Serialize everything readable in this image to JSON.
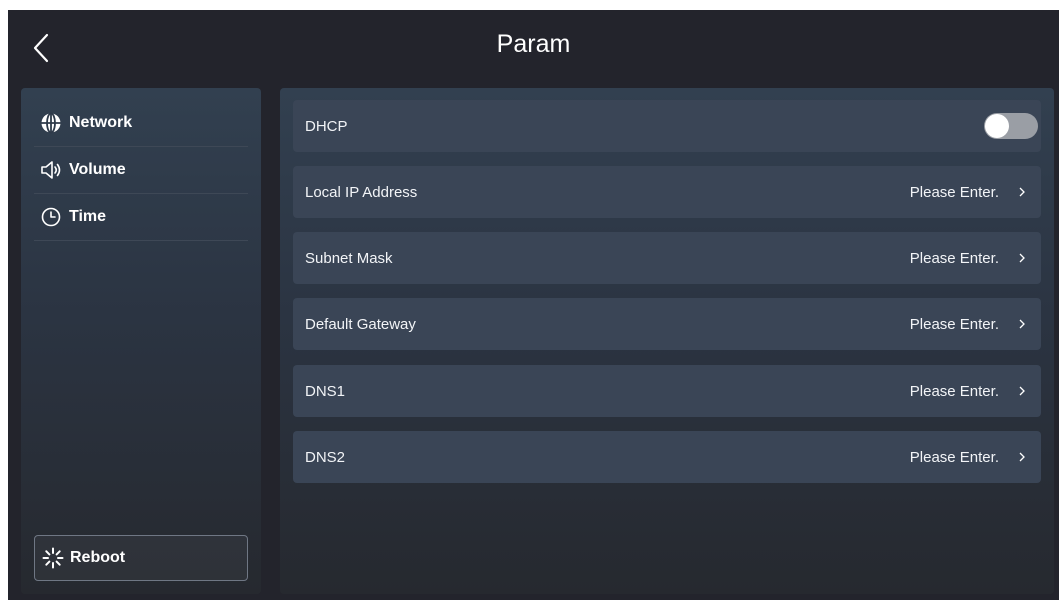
{
  "header": {
    "title": "Param"
  },
  "sidebar": {
    "items": [
      {
        "label": "Network",
        "icon": "globe-icon"
      },
      {
        "label": "Volume",
        "icon": "speaker-icon"
      },
      {
        "label": "Time",
        "icon": "clock-icon"
      }
    ],
    "reboot": {
      "label": "Reboot",
      "icon": "loading-icon"
    }
  },
  "settings": {
    "dhcp": {
      "label": "DHCP",
      "enabled": false
    },
    "rows": [
      {
        "label": "Local IP Address",
        "value": "Please Enter."
      },
      {
        "label": "Subnet Mask",
        "value": "Please Enter."
      },
      {
        "label": "Default Gateway",
        "value": "Please Enter."
      },
      {
        "label": "DNS1",
        "value": "Please Enter."
      },
      {
        "label": "DNS2",
        "value": "Please Enter."
      }
    ]
  },
  "colors": {
    "background": "#23242c",
    "panel": "#324050",
    "row": "#3a4556",
    "toggle_off": "#9a9ea5"
  }
}
